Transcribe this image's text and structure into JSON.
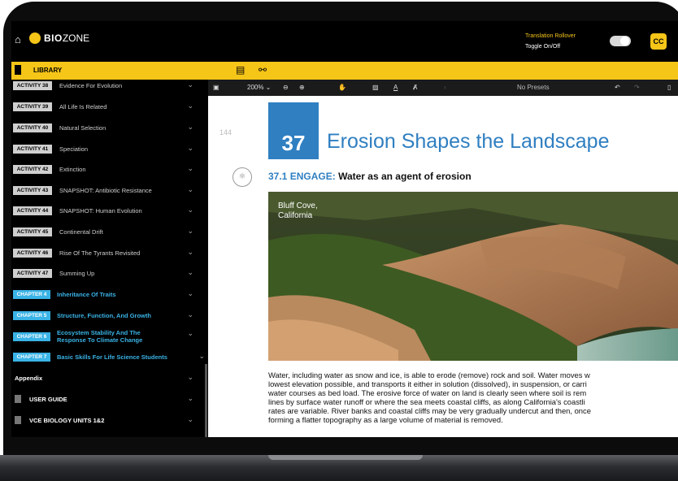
{
  "header": {
    "brand_bio": "BIO",
    "brand_zone": "ZONE",
    "translation_title": "Translation Rollover",
    "translation_toggle": "Toggle On/Off",
    "cc_label": "CC",
    "library_label": "LIBRARY"
  },
  "toolbar": {
    "zoom": "200% ⌄",
    "presets": "No Presets"
  },
  "sidebar": {
    "items": [
      {
        "badge": "ACTIVITY 38",
        "label": "Evidence For Evolution"
      },
      {
        "badge": "ACTIVITY 39",
        "label": "All Life Is Related"
      },
      {
        "badge": "ACTIVITY 40",
        "label": "Natural Selection"
      },
      {
        "badge": "ACTIVITY 41",
        "label": "Speciation"
      },
      {
        "badge": "ACTIVITY 42",
        "label": "Extinction"
      },
      {
        "badge": "ACTIVITY 43",
        "label": "SNAPSHOT: Antibiotic Resistance"
      },
      {
        "badge": "ACTIVITY 44",
        "label": "SNAPSHOT: Human Evolution"
      },
      {
        "badge": "ACTIVITY 45",
        "label": "Continental Drift"
      },
      {
        "badge": "ACTIVITY 46",
        "label": "Rise Of The Tyrants Revisited"
      },
      {
        "badge": "ACTIVITY 47",
        "label": "Summing Up"
      }
    ],
    "chapters": [
      {
        "badge": "CHAPTER 4",
        "label": "Inheritance Of Traits"
      },
      {
        "badge": "CHAPTER 5",
        "label": "Structure, Function, And Growth"
      },
      {
        "badge": "CHAPTER 6",
        "label": "Ecosystem Stability And The Response To Climate Change"
      },
      {
        "badge": "CHAPTER 7",
        "label": "Basic Skills For Life Science Students"
      }
    ],
    "appendix": "Appendix",
    "user_guide": "USER GUIDE",
    "vce": "VCE BIOLOGY UNITS 1&2"
  },
  "document": {
    "page_number": "144",
    "activity_number": "37",
    "title": "Erosion Shapes the Landscape",
    "section_number": "37.1",
    "section_label": "ENGAGE:",
    "section_title": "Water as an agent of erosion",
    "photo_caption_line1": "Bluff Cove,",
    "photo_caption_line2": "California",
    "body_lines": [
      "Water, including water as snow and ice, is able to erode (remove) rock and soil. Water moves w",
      "lowest elevation possible, and transports it either in solution (dissolved), in suspension, or carri",
      "water courses as bed load. The erosive force of water on land is clearly seen where soil is rem",
      "lines by surface water runoff or where the sea meets coastal cliffs, as along California's coastli",
      "rates are variable. River banks and coastal cliffs may be very gradually undercut and then, once",
      "forming a flatter topography as a large volume of material is removed."
    ]
  }
}
